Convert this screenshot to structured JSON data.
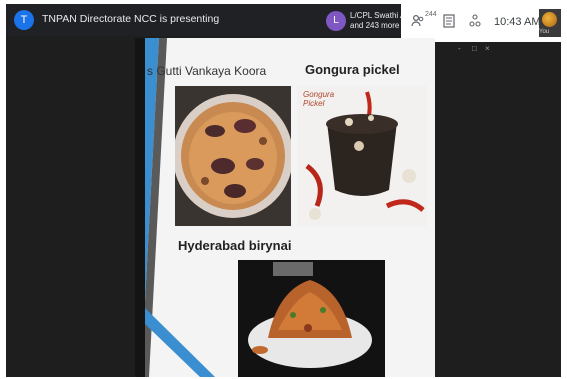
{
  "meeting": {
    "presenter_initial": "T",
    "presenting_text": "TNPAN Directorate NCC is presenting",
    "participant_initial": "L",
    "participant_line1": "L/CPL Swathi AP",
    "participant_line2": "and 243 more",
    "people_count": "244",
    "time": "10:43 AM",
    "self_label": "You",
    "colors": {
      "presenter_avatar": "#1a73e8",
      "participant_avatar": "#7e57c2",
      "bar": "#202124"
    }
  },
  "window_controls": [
    "-",
    "□",
    "×"
  ],
  "slide": {
    "left_title": "s Gutti Vankaya Koora",
    "right_title": "Gongura pickel",
    "bottom_title": "Hyderabad birynai",
    "gongura_img_text_1": "Gongura",
    "gongura_img_text_2": "Pickel"
  },
  "icons": {
    "people": "people-icon",
    "chat": "chat-icon",
    "activities": "activities-icon"
  }
}
